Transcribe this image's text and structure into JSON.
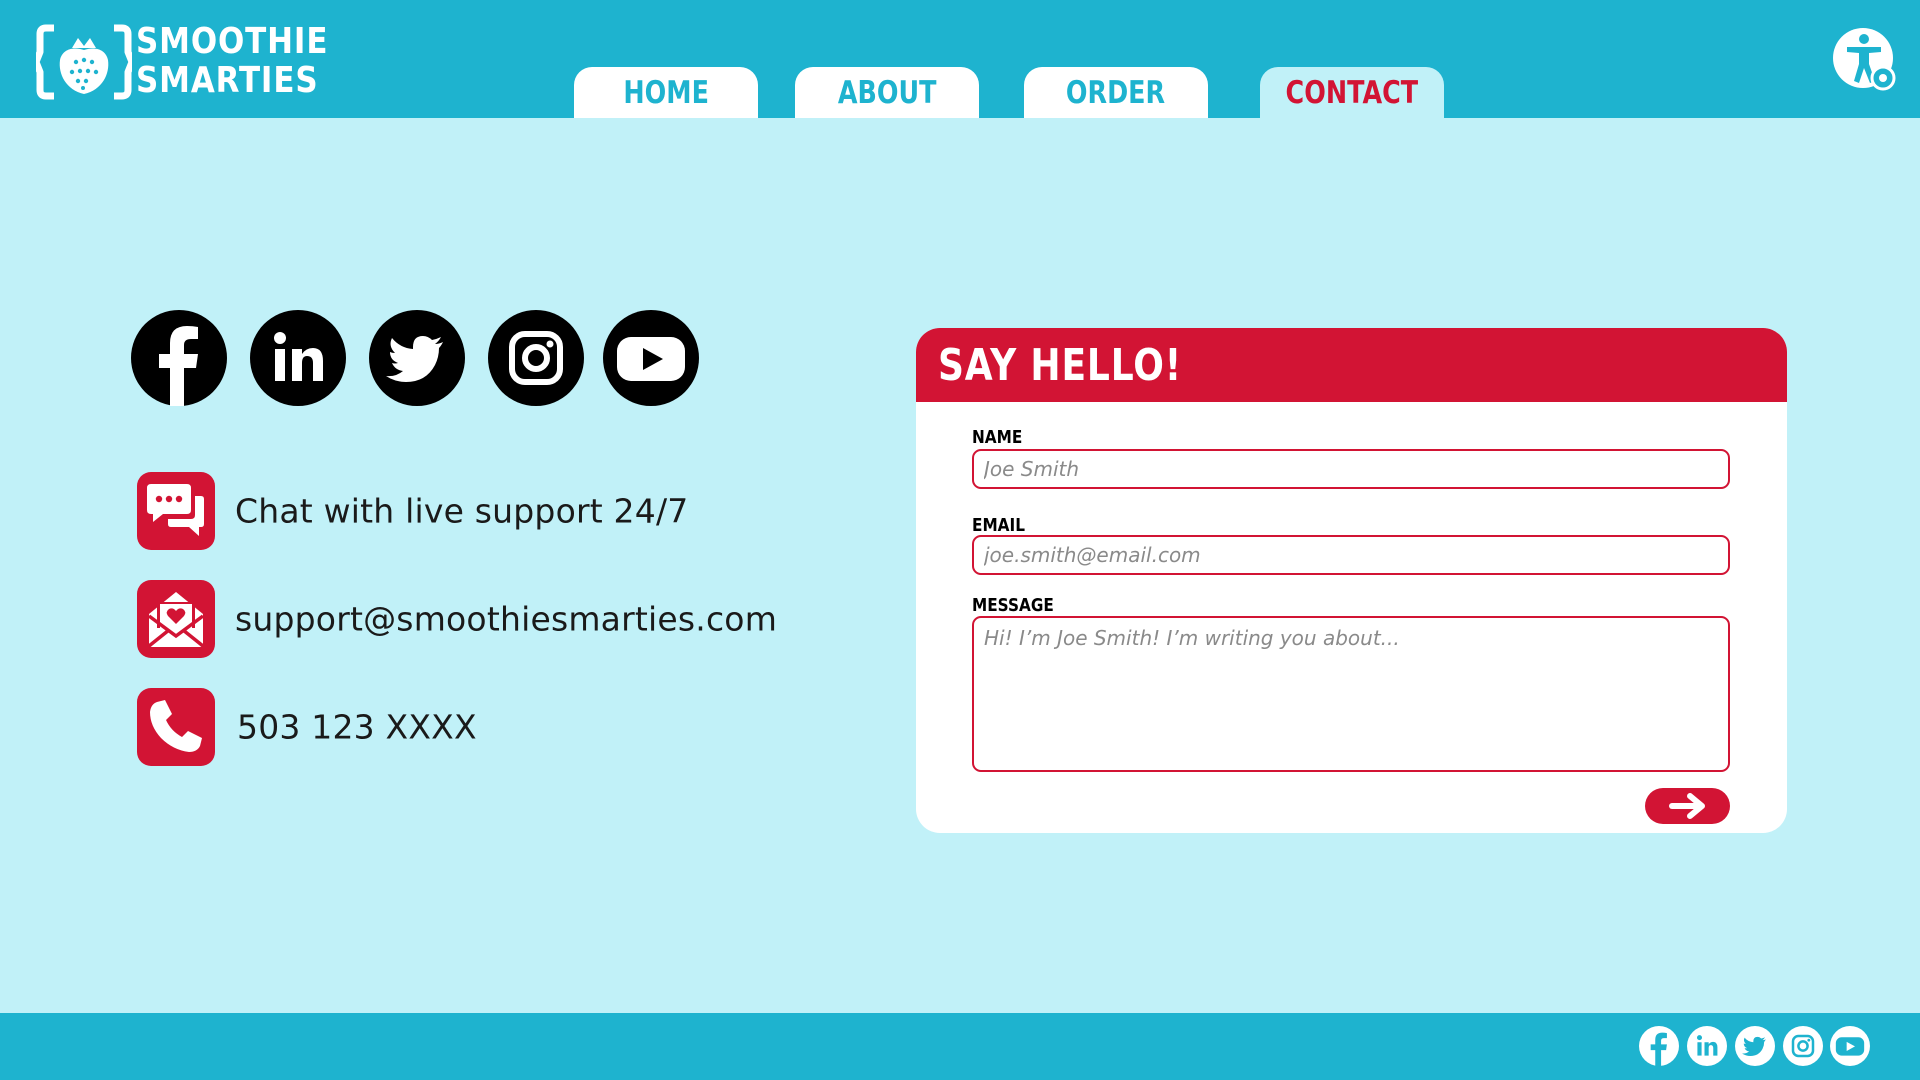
{
  "brand": {
    "name_line1": "SMOOTHIE",
    "name_line2": "SMARTIES",
    "logo_icon": "strawberry-logo-icon"
  },
  "nav": {
    "tabs": [
      {
        "label": "HOME",
        "active": false
      },
      {
        "label": "ABOUT",
        "active": false
      },
      {
        "label": "ORDER",
        "active": false
      },
      {
        "label": "CONTACT",
        "active": true
      }
    ]
  },
  "accessibility": {
    "icon": "accessibility-settings-icon"
  },
  "social": {
    "icons": [
      "facebook-icon",
      "linkedin-icon",
      "twitter-icon",
      "instagram-icon",
      "youtube-icon"
    ]
  },
  "contact": {
    "chat": {
      "icon": "chat-bubbles-icon",
      "text": "Chat with live support 24/7"
    },
    "email": {
      "icon": "envelope-heart-icon",
      "text": "support@smoothiesmarties.com"
    },
    "phone": {
      "icon": "phone-icon",
      "text": "503 123 XXXX"
    }
  },
  "form": {
    "title": "SAY HELLO!",
    "name": {
      "label": "NAME",
      "placeholder": "Joe Smith"
    },
    "email": {
      "label": "EMAIL",
      "placeholder": "joe.smith@email.com"
    },
    "message": {
      "label": "MESSAGE",
      "placeholder": "Hi! I’m Joe Smith! I’m writing you about..."
    },
    "submit_icon": "arrow-right-icon"
  },
  "colors": {
    "primary_teal": "#1eb3cf",
    "background": "#c1f1f8",
    "accent_red": "#d21434"
  }
}
